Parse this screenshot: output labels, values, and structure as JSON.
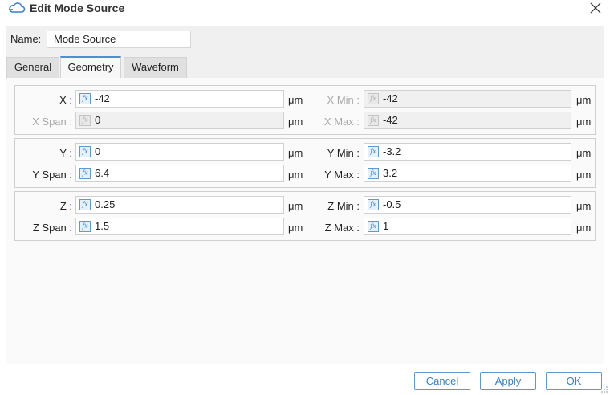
{
  "window": {
    "title": "Edit Mode Source",
    "close_icon": "close-icon",
    "app_icon": "cloud-icon"
  },
  "name": {
    "label": "Name:",
    "value": "Mode Source"
  },
  "tabs": [
    {
      "label": "General",
      "active": false
    },
    {
      "label": "Geometry",
      "active": true
    },
    {
      "label": "Waveform",
      "active": false
    }
  ],
  "formula_icon_text": "fx",
  "geometry": {
    "x": {
      "label": "X :",
      "value": "-42",
      "unit": "μm",
      "min_label": "X Min :",
      "min_value": "-42",
      "min_unit": "μm",
      "span_label": "X Span :",
      "span_value": "0",
      "span_unit": "μm",
      "max_label": "X Max :",
      "max_value": "-42",
      "max_unit": "μm"
    },
    "y": {
      "label": "Y :",
      "value": "0",
      "unit": "μm",
      "min_label": "Y Min :",
      "min_value": "-3.2",
      "min_unit": "μm",
      "span_label": "Y Span :",
      "span_value": "6.4",
      "span_unit": "μm",
      "max_label": "Y Max :",
      "max_value": "3.2",
      "max_unit": "μm"
    },
    "z": {
      "label": "Z :",
      "value": "0.25",
      "unit": "μm",
      "min_label": "Z Min :",
      "min_value": "-0.5",
      "min_unit": "μm",
      "span_label": "Z Span :",
      "span_value": "1.5",
      "span_unit": "μm",
      "max_label": "Z Max :",
      "max_value": "1",
      "max_unit": "μm"
    }
  },
  "footer": {
    "cancel": "Cancel",
    "apply": "Apply",
    "ok": "OK"
  },
  "colors": {
    "accent": "#4a8fd8",
    "button_text": "#3a7fc8"
  }
}
